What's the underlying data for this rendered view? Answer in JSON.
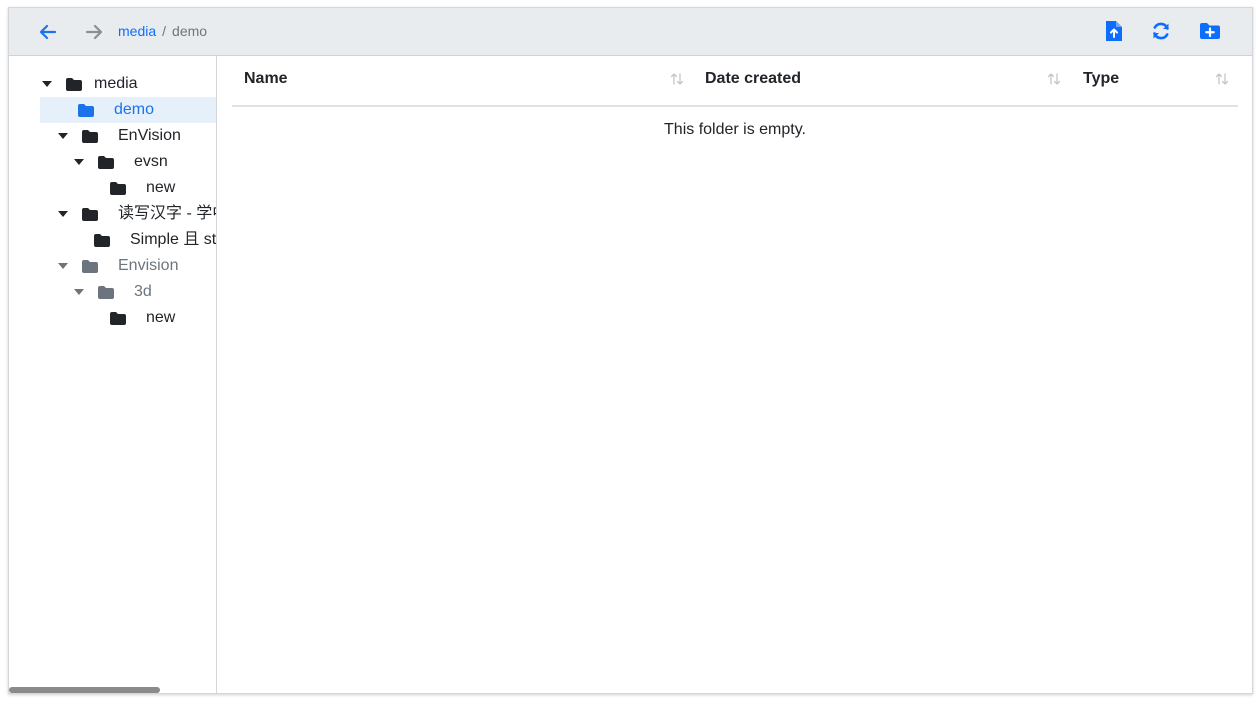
{
  "toolbar": {
    "back_icon": "arrow-left-icon",
    "forward_icon": "arrow-right-icon",
    "breadcrumb": {
      "root": "media",
      "separator": "/",
      "current": "demo"
    },
    "actions": [
      {
        "name": "upload-file-button",
        "icon": "file-upload-icon"
      },
      {
        "name": "refresh-button",
        "icon": "refresh-icon"
      },
      {
        "name": "new-folder-button",
        "icon": "folder-plus-icon"
      }
    ],
    "accent_color": "#0d6efd"
  },
  "tree": [
    {
      "label": "media",
      "expanded": true,
      "state": "normal"
    },
    {
      "label": "demo",
      "expanded": false,
      "state": "selected"
    },
    {
      "label": "EnVision",
      "expanded": true,
      "state": "normal"
    },
    {
      "label": "evsn",
      "expanded": true,
      "state": "normal"
    },
    {
      "label": "new",
      "expanded": false,
      "state": "normal"
    },
    {
      "label": "读写汉字 - 学中文",
      "expanded": true,
      "state": "normal"
    },
    {
      "label": "Simple 且 st",
      "expanded": false,
      "state": "normal"
    },
    {
      "label": "Envision",
      "expanded": true,
      "state": "muted"
    },
    {
      "label": "3d",
      "expanded": true,
      "state": "muted"
    },
    {
      "label": "new",
      "expanded": false,
      "state": "normal"
    }
  ],
  "table": {
    "columns": [
      "Name",
      "Date created",
      "Type"
    ],
    "rows": [],
    "empty_message": "This folder is empty."
  }
}
